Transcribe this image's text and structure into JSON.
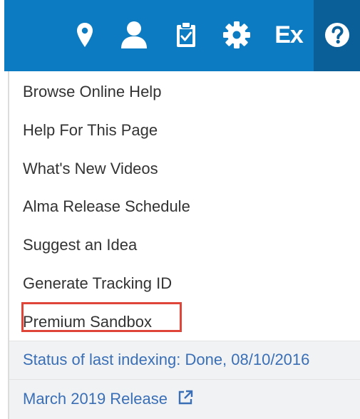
{
  "topbar": {
    "background": "#0d7bc2",
    "icons": [
      "location-pin-icon",
      "user-icon",
      "clipboard-check-icon",
      "gear-icon",
      "ex-icon",
      "help-icon"
    ],
    "ex_label": "Ex"
  },
  "help_menu": {
    "items": [
      "Browse Online Help",
      "Help For This Page",
      "What's New Videos",
      "Alma Release Schedule",
      "Suggest an Idea",
      "Generate Tracking ID",
      "Premium Sandbox"
    ],
    "highlighted_item": "Premium Sandbox",
    "highlight_color": "#e0453a",
    "status_text": "Status of last indexing: Done, 08/10/2016",
    "release_link": "March 2019 Release",
    "link_color": "#3a6fb6"
  }
}
